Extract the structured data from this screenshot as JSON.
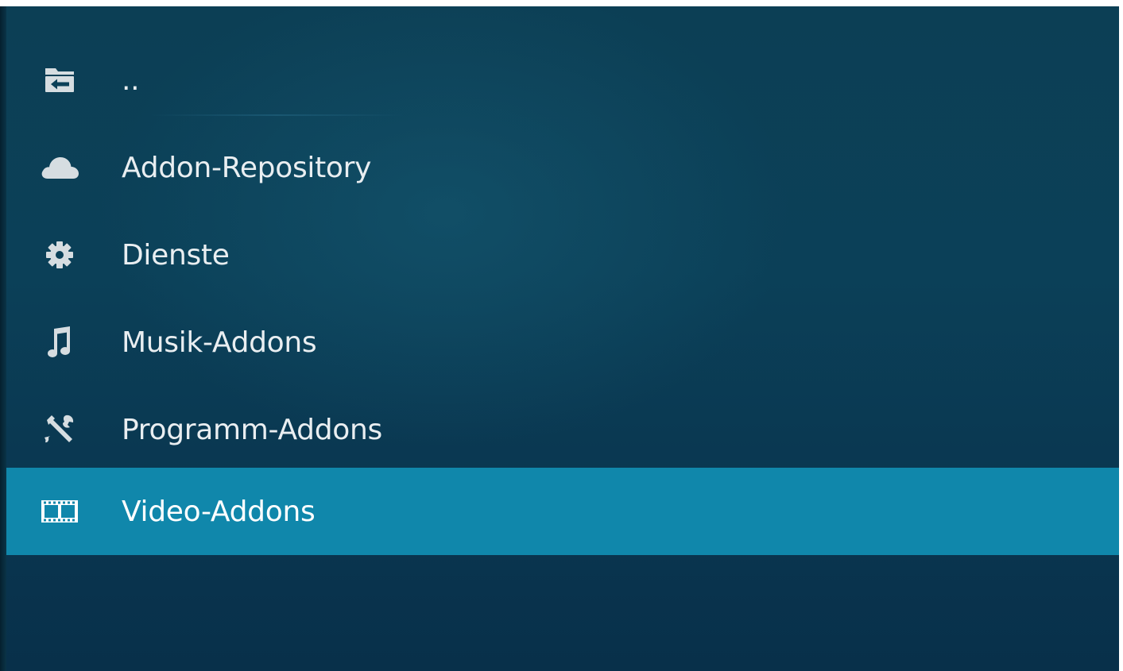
{
  "list": {
    "items": [
      {
        "label": "..",
        "icon": "folder-back-icon"
      },
      {
        "label": "Addon-Repository",
        "icon": "cloud-icon"
      },
      {
        "label": "Dienste",
        "icon": "gear-icon"
      },
      {
        "label": "Musik-Addons",
        "icon": "music-note-icon"
      },
      {
        "label": "Programm-Addons",
        "icon": "tools-icon"
      },
      {
        "label": "Video-Addons",
        "icon": "film-icon"
      }
    ],
    "selected_index": 5
  },
  "colors": {
    "background": "#0b4058",
    "highlight": "#1087ab",
    "text": "#e9eef1",
    "icon": "#d6dde1"
  }
}
